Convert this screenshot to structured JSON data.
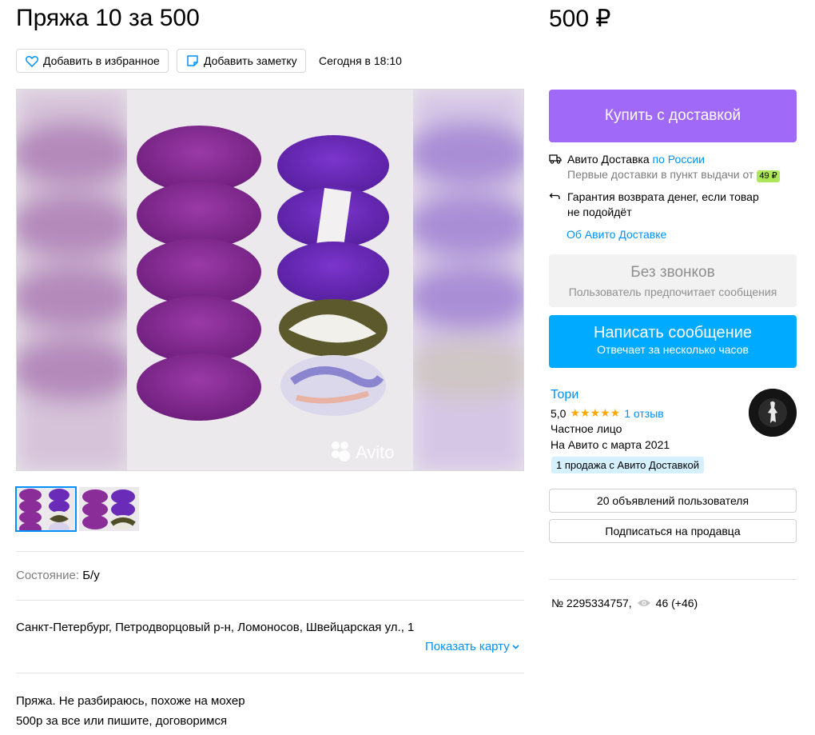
{
  "listing": {
    "title": "Пряжа 10 за 500",
    "price": "500 ₽",
    "add_favorite": "Добавить в избранное",
    "add_note": "Добавить заметку",
    "date": "Сегодня в 18:10",
    "watermark": "Avito",
    "condition_label": "Состояние:",
    "condition_value": "Б/у",
    "address": "Санкт-Петербург, Петродворцовый р-н, Ломоносов, Швейцарская ул., 1",
    "show_map": "Показать карту",
    "description_line1": "Пряжа. Не разбираюсь, похоже на мохер",
    "description_line2": "500р за все или пишите, договоримся"
  },
  "sidebar": {
    "buy_button": "Купить с доставкой",
    "delivery_title": "Авито Доставка",
    "delivery_region": "по России",
    "delivery_first": "Первые доставки в пункт выдачи от",
    "delivery_price": "49 ₽",
    "guarantee_line1": "Гарантия возврата денег, если товар",
    "guarantee_line2": "не подойдёт",
    "about_delivery": "Об Авито Доставке",
    "no_calls_title": "Без звонков",
    "no_calls_sub": "Пользователь предпочитает сообщения",
    "message_button": "Написать сообщение",
    "message_sub": "Отвечает за несколько часов"
  },
  "seller": {
    "name": "Тори",
    "rating": "5,0",
    "stars": "★★★★★",
    "reviews": "1 отзыв",
    "type": "Частное лицо",
    "since": "На Авито с марта 2021",
    "badge": "1 продажа с Авито Доставкой",
    "listings_button": "20 объявлений пользователя",
    "subscribe_button": "Подписаться на продавца"
  },
  "meta": {
    "ad_number": "№ 2295334757,",
    "views": "46 (+46)"
  },
  "colors": {
    "buy": "#a169f7",
    "message": "#00aaff",
    "link": "#0091ff",
    "star": "#ffa800"
  }
}
